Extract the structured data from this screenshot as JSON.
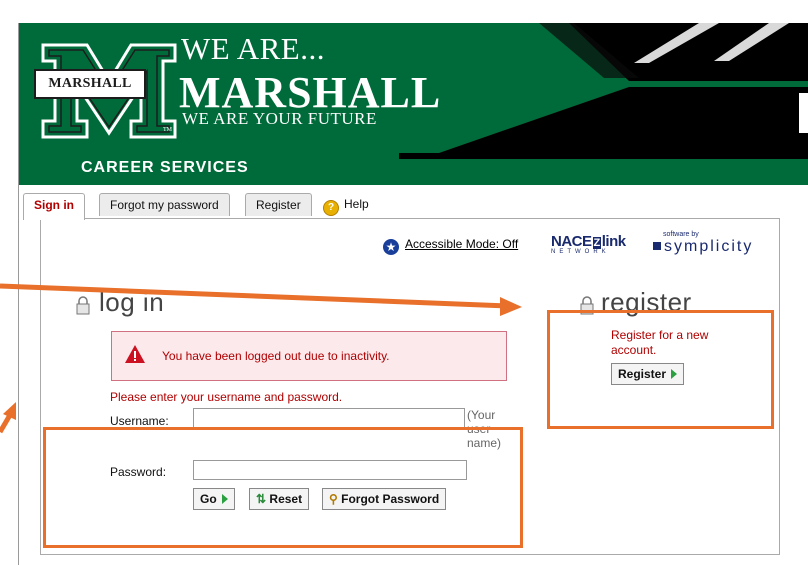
{
  "header": {
    "we_are": "WE ARE...",
    "brand": "MARSHALL",
    "tagline": "WE ARE YOUR FUTURE",
    "plate": "MARSHALL",
    "tm": "TM",
    "section": "CAREER SERVICES",
    "colors": {
      "green": "#006b3a",
      "dark": "#000000"
    }
  },
  "tabs": [
    {
      "label": "Sign in",
      "active": true
    },
    {
      "label": "Forgot my password"
    },
    {
      "label": "Register"
    },
    {
      "label": "Help",
      "icon": "help-icon"
    }
  ],
  "toolbar": {
    "accessible_mode": "Accessible Mode: Off",
    "nace": "NACE",
    "nace_z": "Z",
    "nace_link": "link",
    "nace_network": "NETWORK",
    "software_by": "software by",
    "symplicity": "symplicity"
  },
  "login": {
    "heading": "log in",
    "alert": "You have been logged out due to inactivity.",
    "instructions": "Please enter your username and password.",
    "username_label": "Username:",
    "username_value": "",
    "username_hint": "(Your user name)",
    "password_label": "Password:",
    "password_value": "",
    "go_label": "Go",
    "reset_label": "Reset",
    "forgot_label": "Forgot Password"
  },
  "register": {
    "heading": "register",
    "text": "Register for a new account.",
    "button_label": "Register"
  },
  "annotation_color": "#e8702a"
}
